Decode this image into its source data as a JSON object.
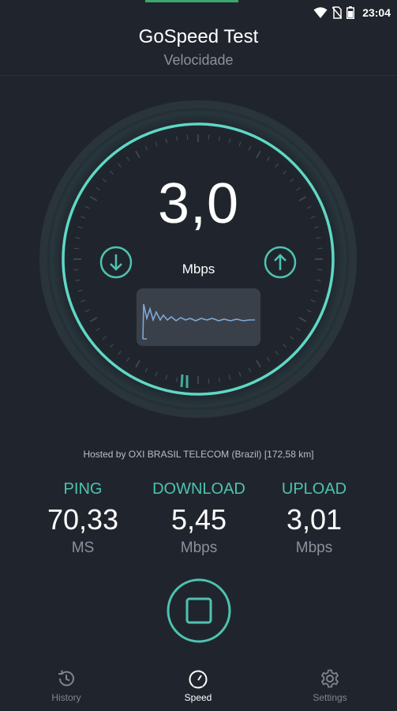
{
  "status_bar": {
    "time": "23:04",
    "icons": [
      "wifi-icon",
      "no-sim-icon",
      "battery-icon"
    ]
  },
  "header": {
    "title": "GoSpeed Test",
    "subtitle": "Velocidade"
  },
  "gauge": {
    "current_speed": "3,0",
    "unit": "Mbps",
    "download_icon": "arrow-down-circle-icon",
    "upload_icon": "arrow-up-circle-icon",
    "graph_icon": "speed-graph"
  },
  "server": {
    "hosted_by": "Hosted by OXI BRASIL TELECOM (Brazil) [172,58 km]"
  },
  "stats": {
    "ping": {
      "label": "PING",
      "value": "70,33",
      "unit": "MS"
    },
    "download": {
      "label": "DOWNLOAD",
      "value": "5,45",
      "unit": "Mbps"
    },
    "upload": {
      "label": "UPLOAD",
      "value": "3,01",
      "unit": "Mbps"
    }
  },
  "controls": {
    "stop_icon": "stop-icon"
  },
  "nav": {
    "items": [
      {
        "label": "History",
        "icon": "history-icon"
      },
      {
        "label": "Speed",
        "icon": "speedometer-icon"
      },
      {
        "label": "Settings",
        "icon": "gear-icon"
      }
    ],
    "active": "Speed"
  },
  "colors": {
    "background": "#20252d",
    "accent": "#4ec3b0",
    "ring": "#5fd8c6",
    "muted": "#8b919b"
  }
}
